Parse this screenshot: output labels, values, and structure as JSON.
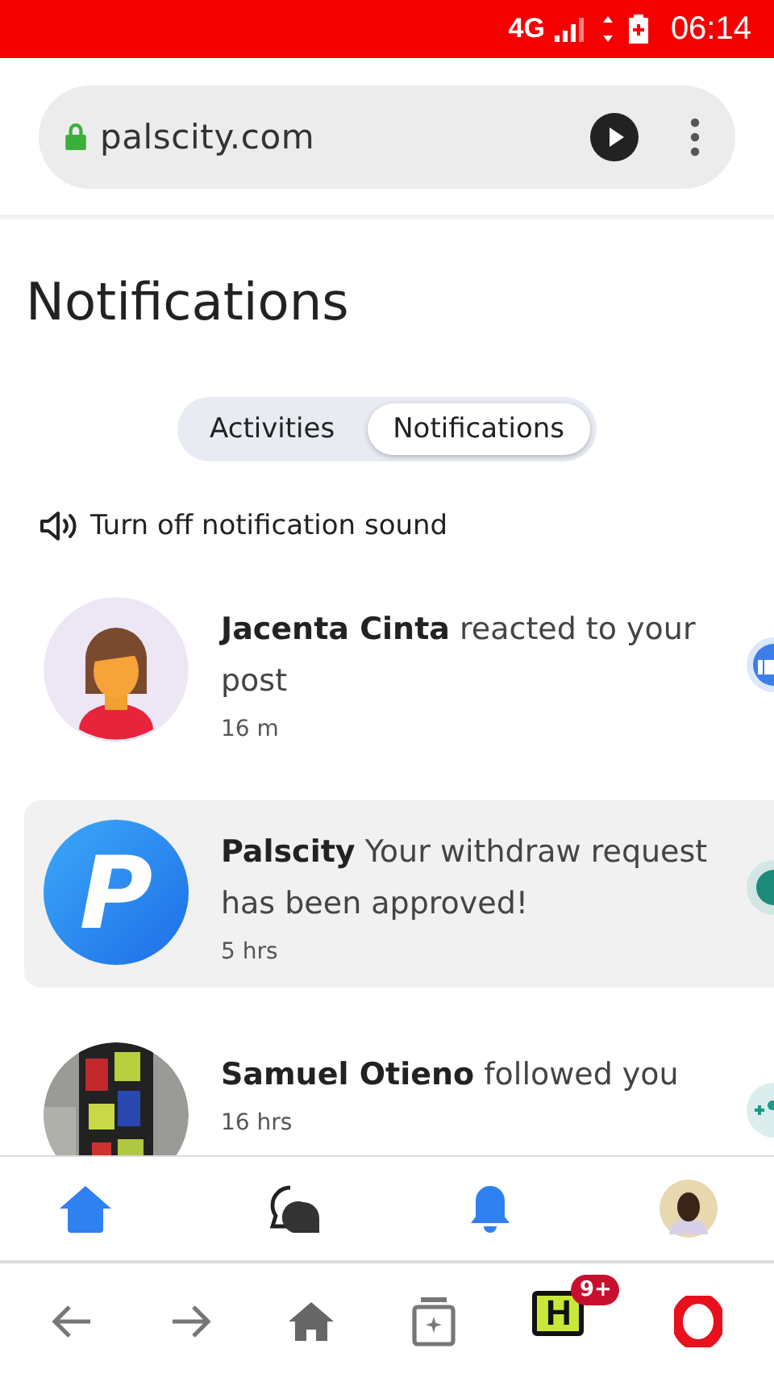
{
  "status_bar": {
    "network": "4G",
    "time": "06:14"
  },
  "browser": {
    "url": "palscity.com"
  },
  "title": "Notifications",
  "tabs": [
    {
      "label": "Activities",
      "selected": false
    },
    {
      "label": "Notifications",
      "selected": true
    }
  ],
  "sound_toggle": "Turn off notification sound",
  "notifications": [
    {
      "kind": "reaction",
      "name": "Jacenta Cinta",
      "text": "reacted to your post",
      "time": "16 m",
      "unread": false
    },
    {
      "kind": "system",
      "logo_letter": "P",
      "name": "Palscity",
      "text": "Your withdraw request has been approved!",
      "time": "5 hrs",
      "unread": true
    },
    {
      "kind": "follow",
      "name": "Samuel Otieno",
      "text": "followed you",
      "time": "16 hrs",
      "unread": false
    }
  ],
  "bottom_nav": [
    {
      "selected": true
    },
    {
      "selected": false
    },
    {
      "selected": true
    },
    {
      "selected": false
    }
  ],
  "browser_bar": {
    "hub_letter": "H",
    "hub_badge": "9+"
  }
}
